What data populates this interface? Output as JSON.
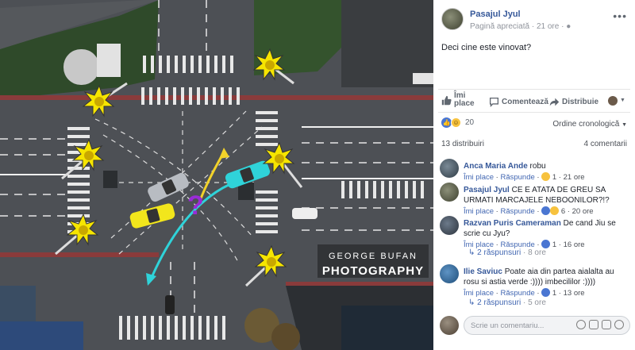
{
  "photo": {
    "watermark_line1": "GEORGE BUFAN",
    "watermark_line2": "PHOTOGRAPHY",
    "overlay_symbol": "?",
    "colors": {
      "yellow_car": "#f2e61c",
      "cyan_car": "#2fd3d9",
      "silver_car": "#b8bcc2",
      "arrow_yellow": "#f2d22a",
      "arrow_cyan": "#2fd3d9",
      "question_mark": "#9a2bd6",
      "traffic_light_glow": "#f6e500"
    }
  },
  "post": {
    "page_name": "Pasajul Jyul",
    "page_type": "Pagină apreciată",
    "time": "21 ore",
    "text": "Deci cine este vinovat?",
    "actions": {
      "like": "Îmi place",
      "comment": "Comentează",
      "share": "Distribuie"
    },
    "reaction_count": "20",
    "sort_order": "Ordine cronologică",
    "shares": "13 distribuiri",
    "comments_count": "4 comentarii"
  },
  "comments": [
    {
      "author": "Anca Maria Ande",
      "text": "robu",
      "like": "Îmi place",
      "reply": "Răspunde",
      "reaction_count": "1",
      "time": "21 ore"
    },
    {
      "author": "Pasajul Jyul",
      "text": "CE E ATATA DE GREU SA URMATI MARCAJELE NEBOONILOR?!?",
      "like": "Îmi place",
      "reply": "Răspunde",
      "reaction_count": "6",
      "time": "20 ore"
    },
    {
      "author": "Razvan Puris Cameraman",
      "text": "De cand Jiu se scrie cu Jyu?",
      "like": "Îmi place",
      "reply": "Răspunde",
      "reaction_count": "1",
      "time": "16 ore",
      "replies": "2 răspunsuri",
      "replies_time": "8 ore"
    },
    {
      "author": "Ilie Saviuc",
      "text": "Poate aia din partea aialalta au rosu si astia verde :)))) imbecililor :))))",
      "like": "Îmi place",
      "reply": "Răspunde",
      "reaction_count": "1",
      "time": "13 ore",
      "replies": "2 răspunsuri",
      "replies_time": "5 ore"
    }
  ],
  "composer": {
    "placeholder": "Scrie un comentariu..."
  },
  "icons": [
    "thumbs-up-icon",
    "comment-icon",
    "share-icon",
    "chevron-down-icon",
    "globe-icon",
    "more-icon",
    "emoji-icon",
    "camera-icon",
    "gif-icon",
    "sticker-icon"
  ]
}
